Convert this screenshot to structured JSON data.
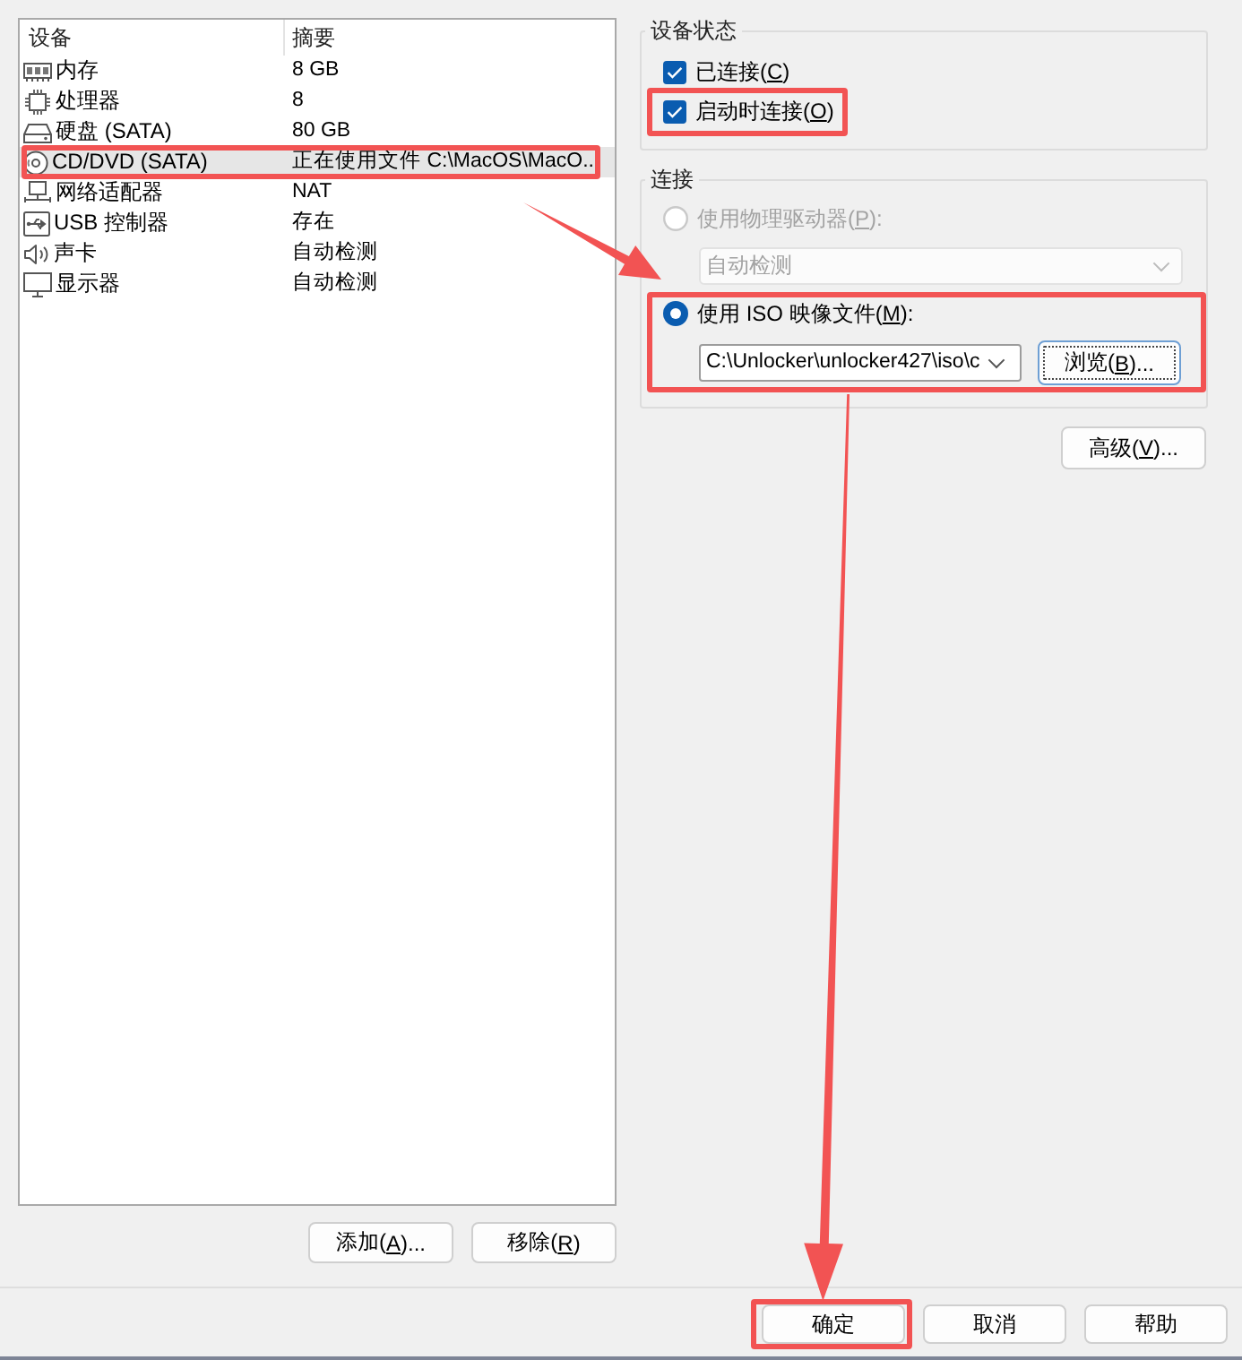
{
  "device_list": {
    "columns": [
      "设备",
      "摘要"
    ],
    "rows": [
      {
        "kind": "memory",
        "name": "内存",
        "summary": "8 GB",
        "selected": false,
        "highlighted": false
      },
      {
        "kind": "processor",
        "name": "处理器",
        "summary": "8",
        "selected": false,
        "highlighted": false
      },
      {
        "kind": "disk",
        "name": "硬盘 (SATA)",
        "summary": "80 GB",
        "selected": false,
        "highlighted": false
      },
      {
        "kind": "cdrom",
        "name": "CD/DVD (SATA)",
        "summary": "正在使用文件 C:\\MacOS\\MacO..",
        "selected": true,
        "highlighted": true
      },
      {
        "kind": "network",
        "name": "网络适配器",
        "summary": "NAT",
        "selected": false,
        "highlighted": false
      },
      {
        "kind": "usb",
        "name": "USB 控制器",
        "summary": "存在",
        "selected": false,
        "highlighted": false
      },
      {
        "kind": "sound",
        "name": "声卡",
        "summary": "自动检测",
        "selected": false,
        "highlighted": false
      },
      {
        "kind": "display",
        "name": "显示器",
        "summary": "自动检测",
        "selected": false,
        "highlighted": false
      }
    ]
  },
  "list_buttons": [
    {
      "label": {
        "before": "添加(",
        "key": "A",
        "after": ")..."
      }
    },
    {
      "label": {
        "before": "移除(",
        "key": "R",
        "after": ")"
      }
    }
  ],
  "device_status": {
    "title": "设备状态",
    "options": [
      {
        "label": {
          "before": "已连接(",
          "key": "C",
          "after": ")"
        },
        "checked": true,
        "highlighted": false
      },
      {
        "label": {
          "before": "启动时连接(",
          "key": "O",
          "after": ")"
        },
        "checked": true,
        "highlighted": true
      }
    ]
  },
  "connection": {
    "title": "连接",
    "options": [
      {
        "kind": "physical",
        "label": {
          "before": "使用物理驱动器(",
          "key": "P",
          "after": "):"
        },
        "selected": false,
        "disabled": true,
        "highlighted": false,
        "drive_select": {
          "value": "自动检测",
          "disabled": true
        }
      },
      {
        "kind": "iso",
        "label": {
          "before": "使用 ISO 映像文件(",
          "key": "M",
          "after": "):"
        },
        "selected": true,
        "disabled": false,
        "highlighted": true,
        "iso_path": {
          "value": "C:\\Unlocker\\unlocker427\\iso\\c"
        },
        "browse_button": {
          "label": {
            "before": "浏览(",
            "key": "B",
            "after": ")..."
          },
          "focused": true
        }
      }
    ]
  },
  "advanced_button": {
    "label": {
      "before": "高级(",
      "key": "V",
      "after": ")..."
    }
  },
  "dialog_buttons": [
    {
      "label": "确定",
      "highlighted": true
    },
    {
      "label": "取消",
      "highlighted": false
    },
    {
      "label": "帮助",
      "highlighted": false
    }
  ]
}
